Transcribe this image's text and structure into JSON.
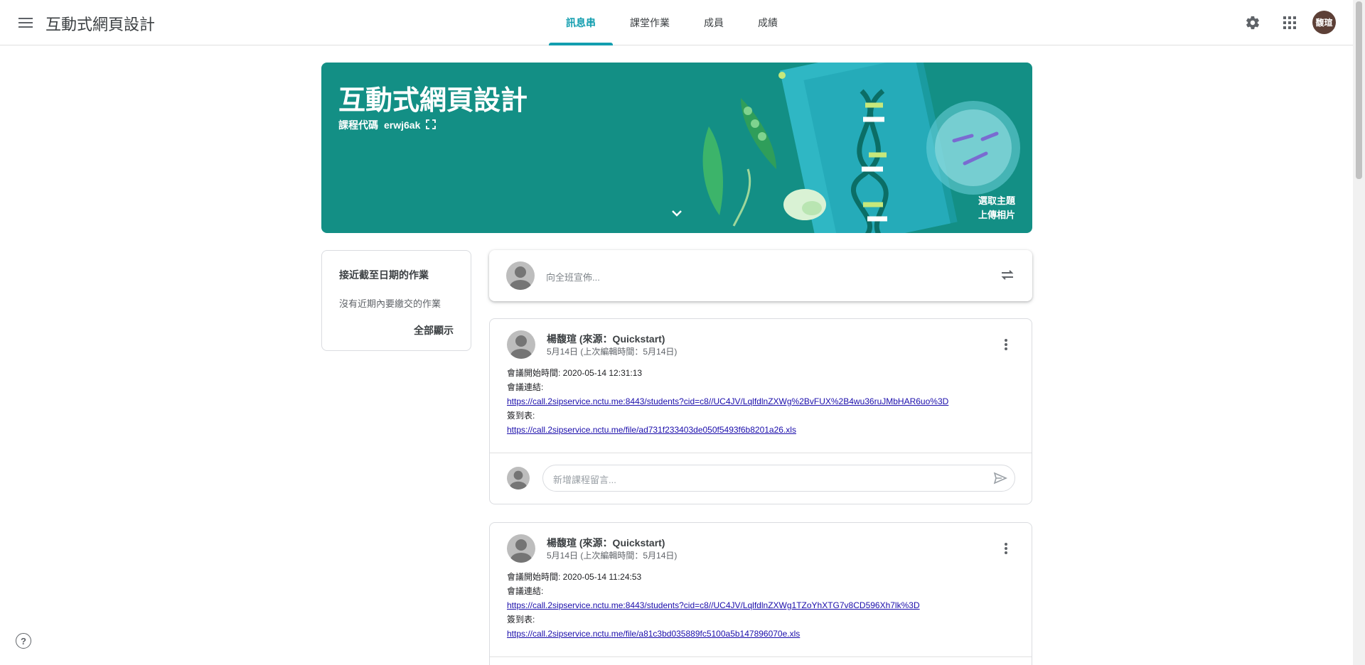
{
  "header": {
    "title": "互動式網頁設計",
    "tabs": [
      {
        "label": "訊息串",
        "active": true
      },
      {
        "label": "課堂作業",
        "active": false
      },
      {
        "label": "成員",
        "active": false
      },
      {
        "label": "成績",
        "active": false
      }
    ],
    "avatar_text": "馥瑄",
    "icons": [
      "menu-icon",
      "settings-icon",
      "apps-icon"
    ]
  },
  "banner": {
    "title": "互動式網頁設計",
    "code_label": "課程代碼",
    "code_value": "erwj6ak",
    "select_theme": "選取主題",
    "upload_photo": "上傳相片",
    "color": "#138f85"
  },
  "upcoming": {
    "title": "接近截至日期的作業",
    "empty": "沒有近期內要繳交的作業",
    "view_all": "全部顯示"
  },
  "announce": {
    "placeholder": "向全班宣佈..."
  },
  "posts": [
    {
      "author": "楊馥瑄 (來源：Quickstart)",
      "date": "5月14日 (上次編輯時間：5月14日)",
      "start_label": "會議開始時間: 2020-05-14 12:31:13",
      "link_label": "會議連結:",
      "link_url": "https://call.2sipservice.nctu.me:8443/students?cid=c8//UC4JV/LqlfdlnZXWg%2BvFUX%2B4wu36ruJMbHAR6uo%3D",
      "signin_label": "簽到表:",
      "signin_url": "https://call.2sipservice.nctu.me/file/ad731f233403de050f5493f6b8201a26.xls",
      "comment_placeholder": "新增課程留言..."
    },
    {
      "author": "楊馥瑄 (來源：Quickstart)",
      "date": "5月14日 (上次編輯時間：5月14日)",
      "start_label": "會議開始時間: 2020-05-14 11:24:53",
      "link_label": "會議連結:",
      "link_url": "https://call.2sipservice.nctu.me:8443/students?cid=c8//UC4JV/LqlfdlnZXWg1TZoYhXTG7v8CD596Xh7lk%3D",
      "signin_label": "簽到表:",
      "signin_url": "https://call.2sipservice.nctu.me/file/a81c3bd035889fc5100a5b147896070e.xls"
    }
  ],
  "colors": {
    "accent": "#129eaf",
    "link": "#1a0dab"
  }
}
